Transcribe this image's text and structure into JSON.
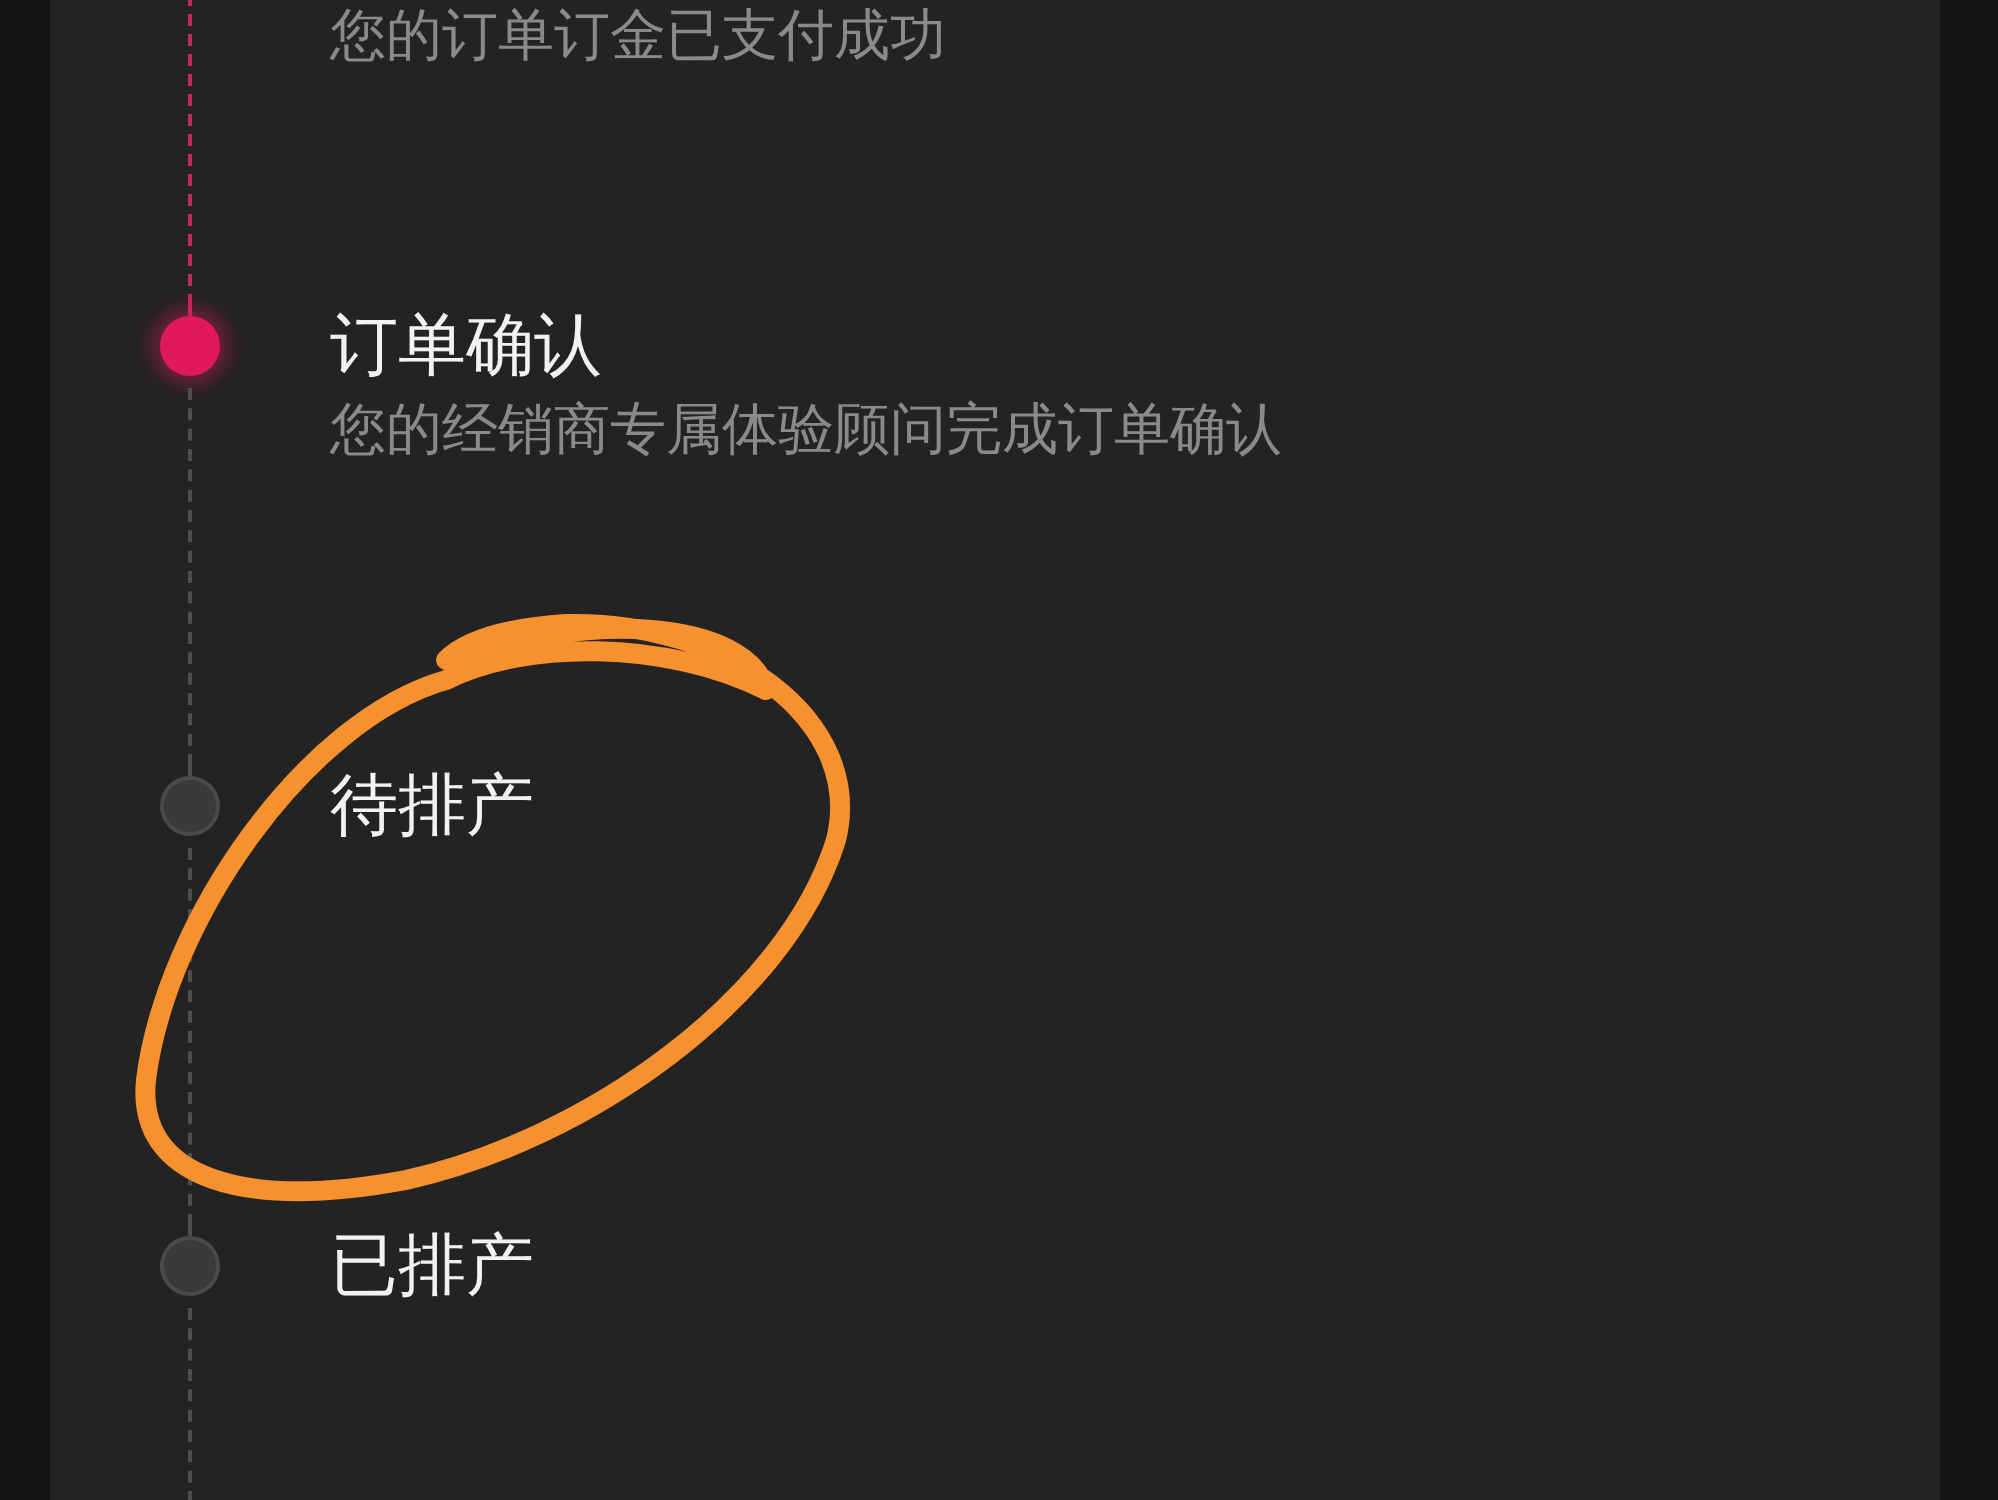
{
  "steps": [
    {
      "description": "您的订单订金已支付成功",
      "reached": true,
      "current": false
    },
    {
      "title": "订单确认",
      "description": "您的经销商专属体验顾问完成订单确认",
      "reached": true,
      "current": true
    },
    {
      "title": "待排产",
      "reached": false,
      "current": false
    },
    {
      "title": "已排产",
      "reached": false,
      "current": false
    }
  ],
  "annotation": {
    "kind": "freehand-circle"
  }
}
